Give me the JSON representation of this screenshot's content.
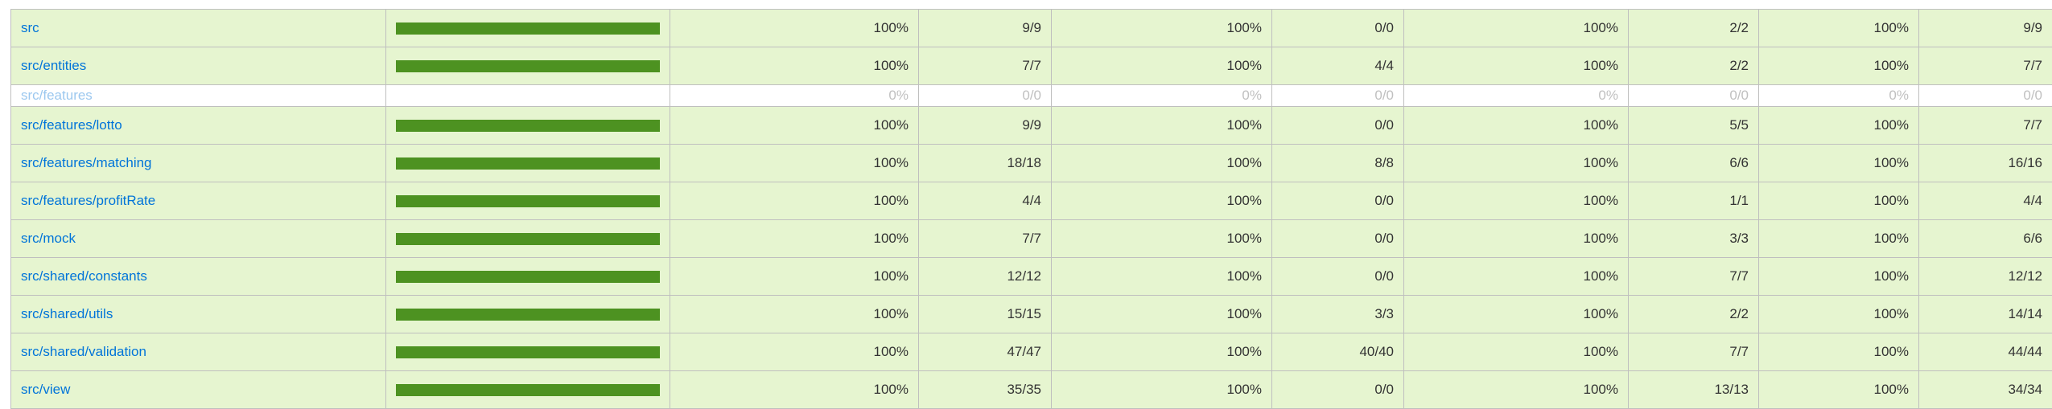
{
  "coverage_table": {
    "rows": [
      {
        "file": "src",
        "fill_fraction": 1.0,
        "statements_pct": "100%",
        "statements": "9/9",
        "branches_pct": "100%",
        "branches": "0/0",
        "functions_pct": "100%",
        "functions": "2/2",
        "lines_pct": "100%",
        "lines": "9/9",
        "status": "high"
      },
      {
        "file": "src/entities",
        "fill_fraction": 1.0,
        "statements_pct": "100%",
        "statements": "7/7",
        "branches_pct": "100%",
        "branches": "4/4",
        "functions_pct": "100%",
        "functions": "2/2",
        "lines_pct": "100%",
        "lines": "7/7",
        "status": "high"
      },
      {
        "file": "src/features",
        "fill_fraction": 0.0,
        "statements_pct": "0%",
        "statements": "0/0",
        "branches_pct": "0%",
        "branches": "0/0",
        "functions_pct": "0%",
        "functions": "0/0",
        "lines_pct": "0%",
        "lines": "0/0",
        "status": "empty"
      },
      {
        "file": "src/features/lotto",
        "fill_fraction": 1.0,
        "statements_pct": "100%",
        "statements": "9/9",
        "branches_pct": "100%",
        "branches": "0/0",
        "functions_pct": "100%",
        "functions": "5/5",
        "lines_pct": "100%",
        "lines": "7/7",
        "status": "high"
      },
      {
        "file": "src/features/matching",
        "fill_fraction": 1.0,
        "statements_pct": "100%",
        "statements": "18/18",
        "branches_pct": "100%",
        "branches": "8/8",
        "functions_pct": "100%",
        "functions": "6/6",
        "lines_pct": "100%",
        "lines": "16/16",
        "status": "high"
      },
      {
        "file": "src/features/profitRate",
        "fill_fraction": 1.0,
        "statements_pct": "100%",
        "statements": "4/4",
        "branches_pct": "100%",
        "branches": "0/0",
        "functions_pct": "100%",
        "functions": "1/1",
        "lines_pct": "100%",
        "lines": "4/4",
        "status": "high"
      },
      {
        "file": "src/mock",
        "fill_fraction": 1.0,
        "statements_pct": "100%",
        "statements": "7/7",
        "branches_pct": "100%",
        "branches": "0/0",
        "functions_pct": "100%",
        "functions": "3/3",
        "lines_pct": "100%",
        "lines": "6/6",
        "status": "high"
      },
      {
        "file": "src/shared/constants",
        "fill_fraction": 1.0,
        "statements_pct": "100%",
        "statements": "12/12",
        "branches_pct": "100%",
        "branches": "0/0",
        "functions_pct": "100%",
        "functions": "7/7",
        "lines_pct": "100%",
        "lines": "12/12",
        "status": "high"
      },
      {
        "file": "src/shared/utils",
        "fill_fraction": 1.0,
        "statements_pct": "100%",
        "statements": "15/15",
        "branches_pct": "100%",
        "branches": "3/3",
        "functions_pct": "100%",
        "functions": "2/2",
        "lines_pct": "100%",
        "lines": "14/14",
        "status": "high"
      },
      {
        "file": "src/shared/validation",
        "fill_fraction": 1.0,
        "statements_pct": "100%",
        "statements": "47/47",
        "branches_pct": "100%",
        "branches": "40/40",
        "functions_pct": "100%",
        "functions": "7/7",
        "lines_pct": "100%",
        "lines": "44/44",
        "status": "high"
      },
      {
        "file": "src/view",
        "fill_fraction": 1.0,
        "statements_pct": "100%",
        "statements": "35/35",
        "branches_pct": "100%",
        "branches": "0/0",
        "functions_pct": "100%",
        "functions": "13/13",
        "lines_pct": "100%",
        "lines": "34/34",
        "status": "high"
      }
    ]
  },
  "colors": {
    "high_row_bg": "#e6f5d0",
    "bar_fill": "#4d9221",
    "link": "#0074d9"
  }
}
